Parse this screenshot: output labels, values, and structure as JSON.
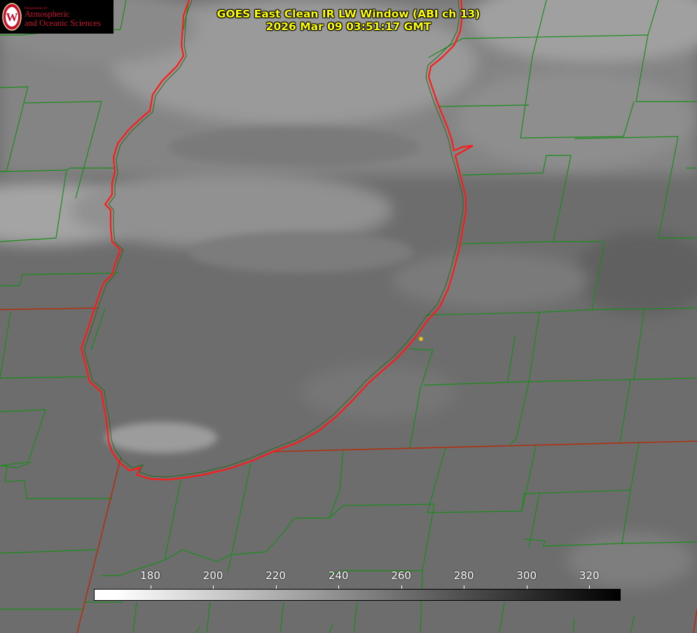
{
  "title": {
    "line1": "GOES East Clean IR LW Window (ABI ch 13)",
    "line2": "2026 Mar 09 03:51:17 GMT"
  },
  "logo": {
    "department": "Department of",
    "line1": "Atmospheric",
    "line2": "and Oceanic Sciences",
    "seal_letter": "W"
  },
  "colorbar": {
    "label_values": [
      "180",
      "200",
      "220",
      "240",
      "260",
      "280",
      "300",
      "320"
    ],
    "min": 162,
    "max": 330,
    "colors": {
      "cold": "#ffffff",
      "warm": "#000000"
    }
  },
  "map_colors": {
    "county_lines": "#1a8c1a",
    "state_lines": "#b03010",
    "shoreline": "#ff1a1a",
    "marker": "#e0c020"
  }
}
